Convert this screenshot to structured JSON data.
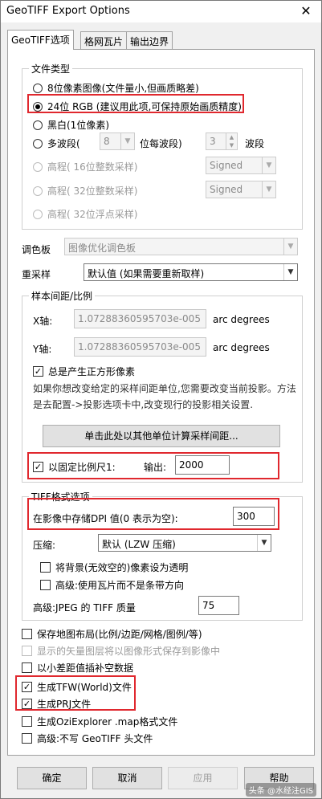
{
  "window": {
    "title": "GeoTIFF Export Options",
    "close_glyph": "✕"
  },
  "tabs": [
    {
      "label": "GeoTIFF选项",
      "active": true
    },
    {
      "label": "格网瓦片",
      "active": false
    },
    {
      "label": "输出边界",
      "active": false
    }
  ],
  "file_type": {
    "group_label": "文件类型",
    "options": [
      {
        "label": "8位像素图像(文件量小,但画质略差)",
        "selected": false,
        "enabled": true
      },
      {
        "label": "24位 RGB (建议用此项,可保持原始画质精度)",
        "selected": true,
        "enabled": true
      },
      {
        "label": "黑白(1位像素)",
        "selected": false,
        "enabled": true
      },
      {
        "label": "多波段(",
        "selected": false,
        "enabled": true
      },
      {
        "label": "高程( 16位整数采样)",
        "selected": false,
        "enabled": false
      },
      {
        "label": "高程( 32位整数采样)",
        "selected": false,
        "enabled": false
      },
      {
        "label": "高程( 32位浮点采样)",
        "selected": false,
        "enabled": false
      }
    ],
    "multiband_bits_value": "8",
    "multiband_bits_suffix": "位每波段)",
    "multiband_count_value": "3",
    "multiband_count_suffix": "波段",
    "signed_value": "Signed"
  },
  "palette": {
    "label": "调色板",
    "value": "图像优化调色板"
  },
  "resample": {
    "label": "重采样",
    "value": "默认值 (如果需要重新取样)"
  },
  "spacing": {
    "group_label": "样本间距/比例",
    "x_label": "X轴:",
    "x_value": "1.07288360595703e-005",
    "y_label": "Y轴:",
    "y_value": "1.07288360595703e-005",
    "unit": "arc degrees",
    "square_label": "总是产生正方形像素",
    "square_checked": true,
    "description": "如果你想改变给定的采样间距单位,您需要改变当前投影。方法是去配置->投影选项卡中,改变现行的投影相关设置.",
    "calc_button": "单击此处以其他单位计算采样间距...",
    "fixed_scale_label": "以固定比例尺1:",
    "fixed_scale_checked": true,
    "output_label": "输出:",
    "output_value": "2000"
  },
  "tiff": {
    "group_label": "TIFF格式选项",
    "dpi_label": "在影像中存储DPI 值(0 表示为空):",
    "dpi_value": "300",
    "compress_label": "压缩:",
    "compress_value": "默认 (LZW 压缩)",
    "transparent_label": "将背景(无效空的)像素设为透明",
    "transparent_checked": false,
    "tiles_label": "高级:使用瓦片而不是条带方向",
    "tiles_checked": false,
    "jpeg_label": "高级:JPEG 的 TIFF 质量",
    "jpeg_value": "75"
  },
  "bottom_options": [
    {
      "label": "保存地图布局(比例/边距/网格/图例/等)",
      "checked": false,
      "enabled": true
    },
    {
      "label": "显示的矢量图层将以图像形式保存到影像中",
      "checked": false,
      "enabled": false
    },
    {
      "label": "以小差距值插补空数据",
      "checked": false,
      "enabled": true
    },
    {
      "label": "生成TFW(World)文件",
      "checked": true,
      "enabled": true
    },
    {
      "label": "生成PRJ文件",
      "checked": true,
      "enabled": true
    },
    {
      "label": "生成OziExplorer .map格式文件",
      "checked": false,
      "enabled": true
    },
    {
      "label": "高级:不写 GeoTIFF 头文件",
      "checked": false,
      "enabled": true
    }
  ],
  "buttons": {
    "ok": "确定",
    "cancel": "取消",
    "apply": "应用",
    "help": "帮助"
  },
  "watermark": "头条 @水经注GIS",
  "colors": {
    "highlight": "#e0282e",
    "window_bg": "#f0f0f0"
  }
}
